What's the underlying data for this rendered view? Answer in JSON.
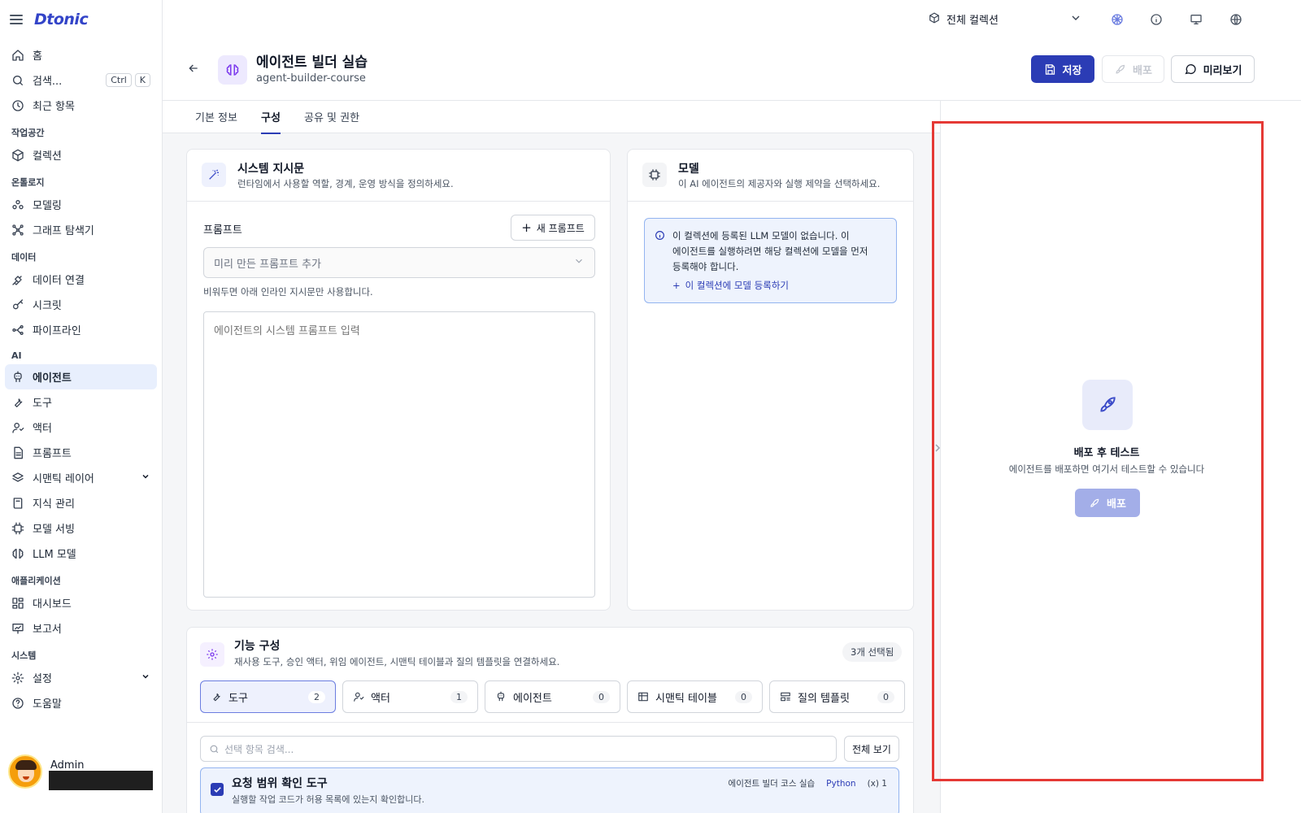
{
  "app": {
    "logo": "Dtonic"
  },
  "sidebar": {
    "top_items": [
      {
        "label": "홈",
        "icon": "home-icon"
      },
      {
        "label": "검색...",
        "icon": "search-icon",
        "shortcut": [
          "Ctrl",
          "K"
        ]
      },
      {
        "label": "최근 항목",
        "icon": "clock-icon"
      }
    ],
    "sections": [
      {
        "label": "작업공간",
        "items": [
          {
            "label": "컬렉션",
            "icon": "box-icon"
          }
        ]
      },
      {
        "label": "온톨로지",
        "items": [
          {
            "label": "모델링",
            "icon": "cluster-icon"
          },
          {
            "label": "그래프 탐색기",
            "icon": "graph-icon"
          }
        ]
      },
      {
        "label": "데이터",
        "items": [
          {
            "label": "데이터 연결",
            "icon": "plug-icon"
          },
          {
            "label": "시크릿",
            "icon": "key-icon"
          },
          {
            "label": "파이프라인",
            "icon": "pipeline-icon"
          }
        ]
      },
      {
        "label": "AI",
        "items": [
          {
            "label": "에이전트",
            "icon": "agent-icon",
            "active": true
          },
          {
            "label": "도구",
            "icon": "wrench-icon"
          },
          {
            "label": "액터",
            "icon": "actor-icon"
          },
          {
            "label": "프롬프트",
            "icon": "document-icon"
          },
          {
            "label": "시맨틱 레이어",
            "icon": "layers-icon",
            "expandable": true
          },
          {
            "label": "지식 관리",
            "icon": "book-icon"
          },
          {
            "label": "모델 서빙",
            "icon": "chip-icon"
          },
          {
            "label": "LLM 모델",
            "icon": "brain-icon"
          }
        ]
      },
      {
        "label": "애플리케이션",
        "items": [
          {
            "label": "대시보드",
            "icon": "dashboard-icon"
          },
          {
            "label": "보고서",
            "icon": "presentation-icon"
          }
        ]
      },
      {
        "label": "시스템",
        "items": [
          {
            "label": "설정",
            "icon": "gear-icon",
            "expandable": true
          },
          {
            "label": "도움말",
            "icon": "help-icon"
          }
        ]
      }
    ],
    "user": {
      "name": "Admin"
    }
  },
  "topbar": {
    "collection": "전체 컬렉션"
  },
  "header": {
    "title": "에이전트 빌더 실습",
    "subtitle": "agent-builder-course",
    "save_label": "저장",
    "deploy_label": "배포",
    "preview_label": "미리보기"
  },
  "tabs": [
    {
      "label": "기본 정보"
    },
    {
      "label": "구성",
      "active": true
    },
    {
      "label": "공유 및 권한"
    }
  ],
  "system_prompt": {
    "title": "시스템 지시문",
    "desc": "런타임에서 사용할 역할, 경계, 운영 방식을 정의하세요.",
    "prompt_label": "프롬프트",
    "new_prompt_label": "새 프롬프트",
    "select_placeholder": "미리 만든 프롬프트 추가",
    "hint": "비워두면 아래 인라인 지시문만 사용합니다.",
    "textarea_placeholder": "에이전트의 시스템 프롬프트 입력"
  },
  "model": {
    "title": "모델",
    "desc": "이 AI 에이전트의 제공자와 실행 제약을 선택하세요.",
    "notice_line1": "이 컬렉션에 등록된 LLM 모델이 없습니다. 이",
    "notice_line2": "에이전트를 실행하려면 해당 컬렉션에 모델을 먼저",
    "notice_line3": "등록해야 합니다.",
    "notice_link": "이 컬렉션에 모델 등록하기"
  },
  "features": {
    "title": "기능 구성",
    "desc": "재사용 도구, 승인 액터, 위임 에이전트, 시맨틱 테이블과 질의 템플릿을 연결하세요.",
    "selected_badge": "3개 선택됨",
    "chips": [
      {
        "label": "도구",
        "count": "2",
        "icon": "wrench-icon",
        "active": true
      },
      {
        "label": "액터",
        "count": "1",
        "icon": "actor-icon"
      },
      {
        "label": "에이전트",
        "count": "0",
        "icon": "agent-icon"
      },
      {
        "label": "시맨틱 테이블",
        "count": "0",
        "icon": "table-icon"
      },
      {
        "label": "질의 템플릿",
        "count": "0",
        "icon": "template-icon"
      }
    ],
    "search_placeholder": "선택 항목 검색...",
    "view_all_label": "전체 보기",
    "tool": {
      "name": "요청 범위 확인 도구",
      "desc": "실행할 작업 코드가 허용 목록에 있는지 확인합니다.",
      "collection": "에이전트 빌더 코스 실습",
      "language": "Python",
      "params": "(x) 1"
    }
  },
  "preview_panel": {
    "title": "배포 후 테스트",
    "desc": "에이전트를 배포하면 여기서 테스트할 수 있습니다",
    "deploy_label": "배포"
  },
  "colors": {
    "primary": "#2b3cb5",
    "highlight": "#e53935",
    "accent_bg": "#eef3fd"
  }
}
